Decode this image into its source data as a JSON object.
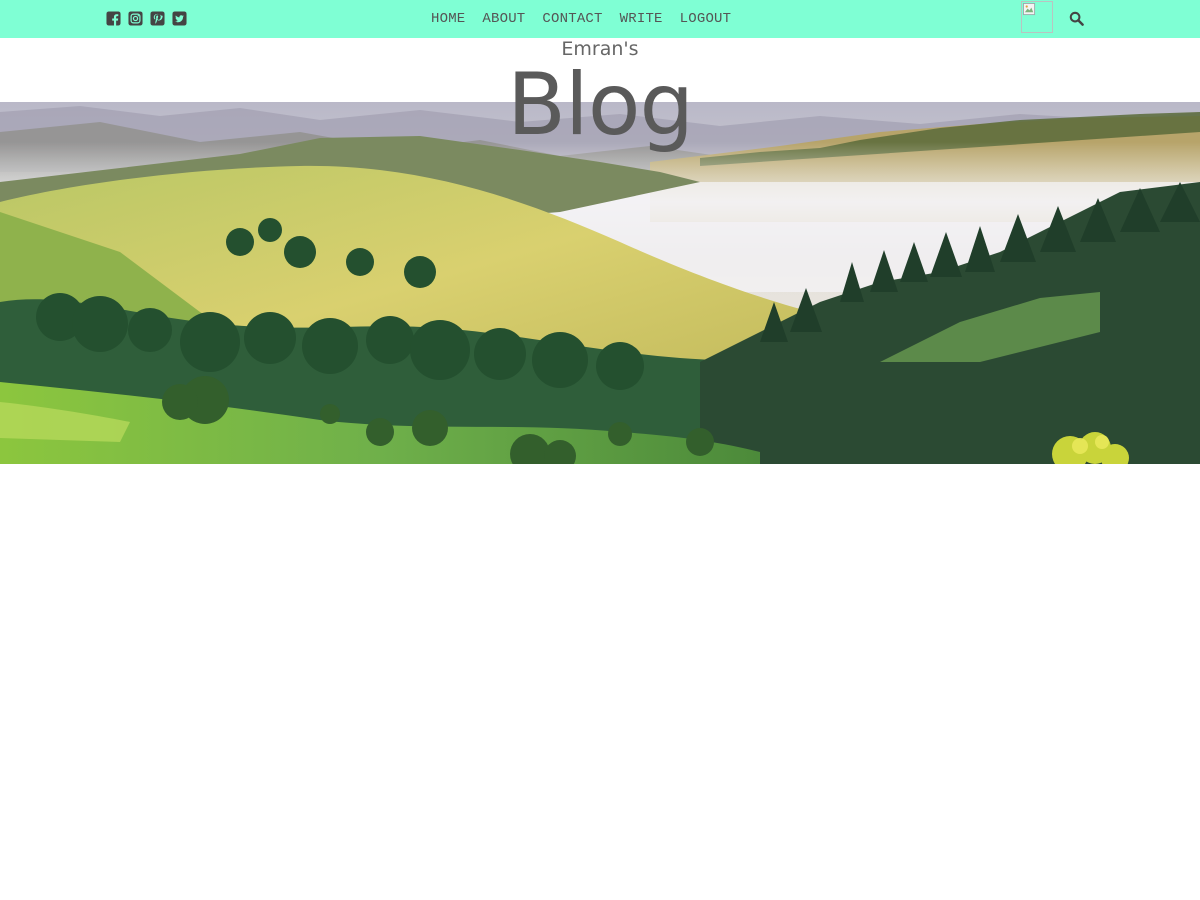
{
  "colors": {
    "topbar_bg": "#7fffd4",
    "nav_text": "#555555",
    "title_text": "#5a5a5a"
  },
  "social_icons": [
    {
      "name": "facebook-square-icon"
    },
    {
      "name": "instagram-square-icon"
    },
    {
      "name": "pinterest-square-icon"
    },
    {
      "name": "twitter-square-icon"
    }
  ],
  "nav": {
    "items": [
      {
        "label": "HOME"
      },
      {
        "label": "ABOUT"
      },
      {
        "label": "CONTACT"
      },
      {
        "label": "WRITE"
      },
      {
        "label": "LOGOUT"
      }
    ]
  },
  "header": {
    "subtitle": "Emran's",
    "title": "Blog"
  },
  "hero": {
    "image": "landscape-hills-forest-mist"
  },
  "icons": {
    "search": "search-icon",
    "avatar": "broken-image-avatar"
  }
}
